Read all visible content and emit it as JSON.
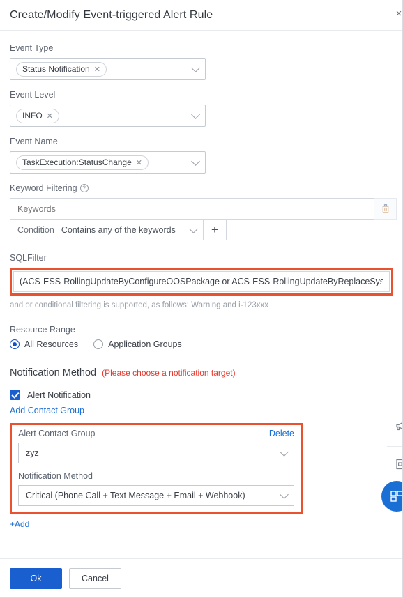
{
  "header": {
    "title": "Create/Modify Event-triggered Alert Rule",
    "close_label": "×"
  },
  "form": {
    "event_type": {
      "label": "Event Type",
      "tag": "Status Notification",
      "tag_remove": "✕"
    },
    "event_level": {
      "label": "Event Level",
      "tag": "INFO",
      "tag_remove": "✕"
    },
    "event_name": {
      "label": "Event Name",
      "tag": "TaskExecution:StatusChange",
      "tag_remove": "✕"
    },
    "keyword_filtering": {
      "label": "Keyword Filtering",
      "help_glyph": "?",
      "keywords_placeholder": "Keywords",
      "keywords_value": "",
      "condition_label": "Condition",
      "condition_value": "Contains any of the keywords",
      "add_label": "+"
    },
    "sql_filter": {
      "label": "SQLFilter",
      "value": "(ACS-ESS-RollingUpdateByConfigureOOSPackage or ACS-ESS-RollingUpdateByReplaceSystemDiskInS",
      "hint": "and or conditional filtering is supported, as follows: Warning and i-123xxx"
    },
    "resource_range": {
      "label": "Resource Range",
      "options": [
        {
          "label": "All Resources",
          "selected": true
        },
        {
          "label": "Application Groups",
          "selected": false
        }
      ]
    },
    "notification_method": {
      "title": "Notification Method",
      "warning": "(Please choose a notification target)",
      "alert_notification_label": "Alert Notification",
      "alert_notification_checked": true,
      "add_contact_group_link": "Add Contact Group",
      "contact_group": {
        "label": "Alert Contact Group",
        "delete_label": "Delete",
        "value": "zyz",
        "method_label": "Notification Method",
        "method_value": "Critical (Phone Call + Text Message + Email + Webhook)"
      },
      "add_link": "+Add"
    }
  },
  "footer": {
    "ok_label": "Ok",
    "cancel_label": "Cancel"
  },
  "edge_widgets": {
    "items": [
      {
        "name": "announcement-icon"
      },
      {
        "name": "document-icon"
      },
      {
        "name": "chat-fab-icon"
      }
    ]
  },
  "colors": {
    "accent": "#1a5fd0",
    "link": "#1a6fd4",
    "highlight": "#e8522f",
    "warning": "#e8372c"
  }
}
